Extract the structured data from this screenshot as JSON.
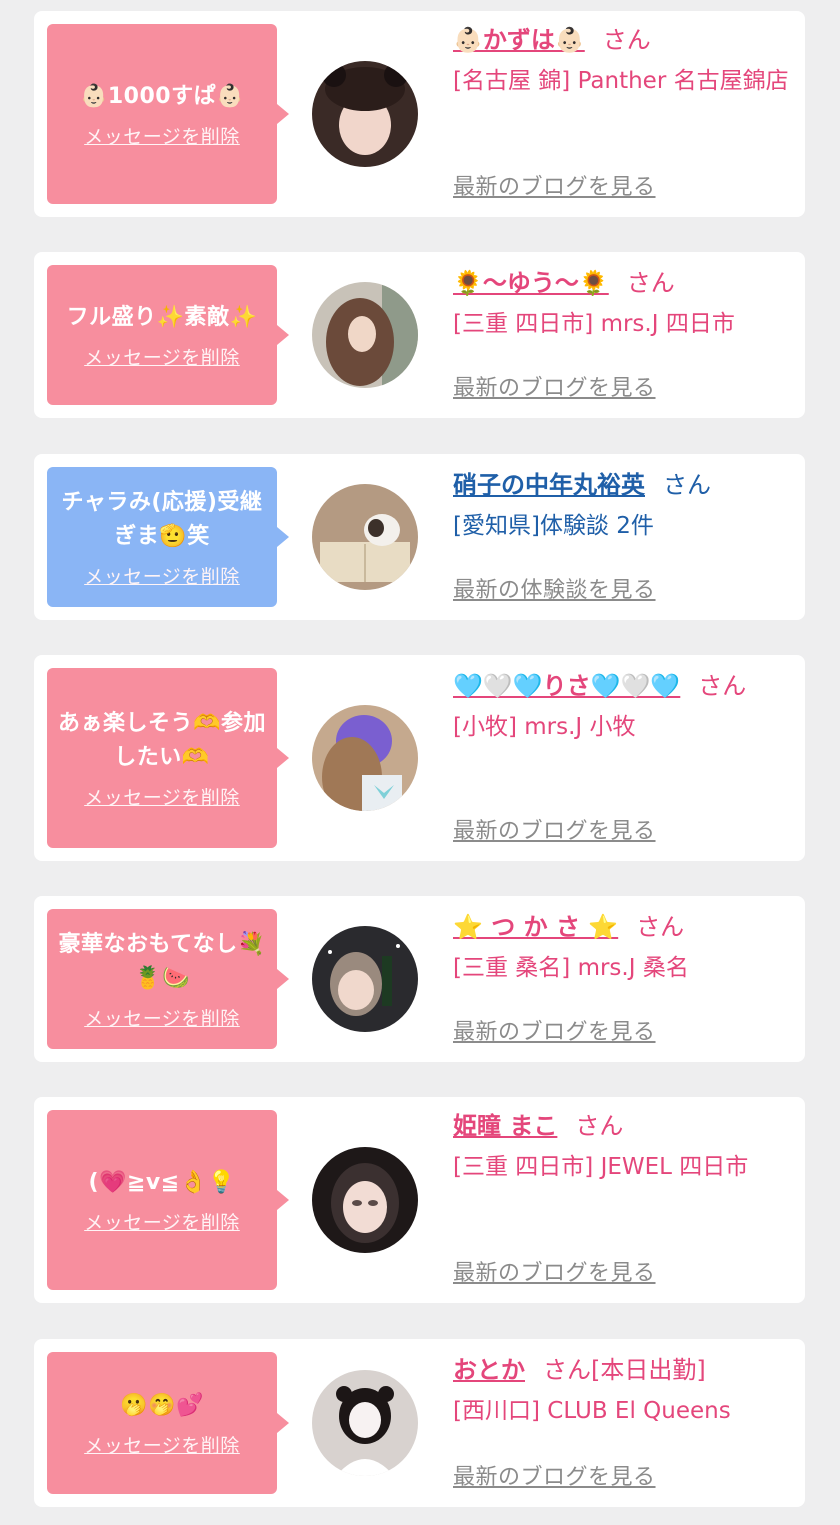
{
  "items": [
    {
      "message": "👶🏻1000すぱ👶🏻",
      "delete_label": "メッセージを削除",
      "name": "👶🏻かずは👶🏻",
      "honorific": "さん",
      "shop": "[名古屋 錦] Panther 名古屋錦店",
      "link_label": "最新のブログを見る",
      "theme": "pink",
      "avatar_color": "#3a2a26"
    },
    {
      "message": "フル盛り✨素敵✨",
      "delete_label": "メッセージを削除",
      "name": "🌻〜ゆう〜🌻",
      "honorific": "さん",
      "shop": "[三重 四日市] mrs.J 四日市",
      "link_label": "最新のブログを見る",
      "theme": "pink",
      "avatar_color": "#6b4a3a"
    },
    {
      "message": "チャラみ(応援)受継ぎま🫡笑",
      "delete_label": "メッセージを削除",
      "name": "硝子の中年丸裕英",
      "honorific": "さん",
      "shop": "[愛知県]体験談 2件",
      "link_label": "最新の体験談を見る",
      "theme": "blue",
      "avatar_color": "#8a7460"
    },
    {
      "message": "あぁ楽しそう🫶参加したい🫶",
      "delete_label": "メッセージを削除",
      "name": "🩵🤍🩵りさ🩵🤍🩵",
      "honorific": "さん",
      "shop": "[小牧] mrs.J 小牧",
      "link_label": "最新のブログを見る",
      "theme": "pink",
      "avatar_color": "#7a5fd0"
    },
    {
      "message": "豪華なおもてなし💐🍍🍉",
      "delete_label": "メッセージを削除",
      "name": "⭐️ つ か さ ⭐️",
      "honorific": "さん",
      "shop": "[三重 桑名] mrs.J 桑名",
      "link_label": "最新のブログを見る",
      "theme": "pink",
      "avatar_color": "#2a2a2e"
    },
    {
      "message": "(💗≧v≦👌💡",
      "delete_label": "メッセージを削除",
      "name": "姫瞳 まこ",
      "honorific": "さん",
      "shop": "[三重 四日市] JEWEL 四日市",
      "link_label": "最新のブログを見る",
      "theme": "pink",
      "avatar_color": "#2b2222"
    },
    {
      "message": "🫢🤭💕",
      "delete_label": "メッセージを削除",
      "name": "おとか",
      "honorific": "さん[本日出勤]",
      "shop": "[西川口] CLUB El Queens",
      "link_label": "最新のブログを見る",
      "theme": "pink",
      "avatar_color": "#d8d2cf"
    }
  ]
}
